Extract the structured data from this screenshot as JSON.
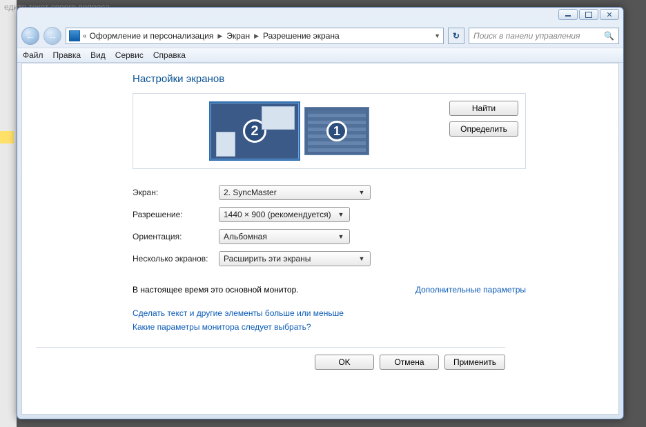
{
  "bg_text": "едите текст своего вопроса",
  "window_controls": {
    "min": "",
    "max": "",
    "close": "✕"
  },
  "breadcrumb": {
    "seg1": "Оформление и персонализация",
    "seg2": "Экран",
    "seg3": "Разрешение экрана"
  },
  "search": {
    "placeholder": "Поиск в панели управления"
  },
  "menu": {
    "file": "Файл",
    "edit": "Правка",
    "view": "Вид",
    "tools": "Сервис",
    "help": "Справка"
  },
  "heading": "Настройки экранов",
  "monitors": {
    "primary_num": "2",
    "secondary_num": "1"
  },
  "buttons": {
    "find": "Найти",
    "identify": "Определить"
  },
  "labels": {
    "display": "Экран:",
    "resolution": "Разрешение:",
    "orientation": "Ориентация:",
    "multidisplay": "Несколько экранов:"
  },
  "values": {
    "display": "2. SyncMaster",
    "resolution": "1440 × 900 (рекомендуется)",
    "orientation": "Альбомная",
    "multidisplay": "Расширить эти экраны"
  },
  "status_text": "В настоящее время это основной монитор.",
  "advanced_link": "Дополнительные параметры",
  "link1": "Сделать текст и другие элементы больше или меньше",
  "link2": "Какие параметры монитора следует выбрать?",
  "footer": {
    "ok": "OK",
    "cancel": "Отмена",
    "apply": "Применить"
  }
}
